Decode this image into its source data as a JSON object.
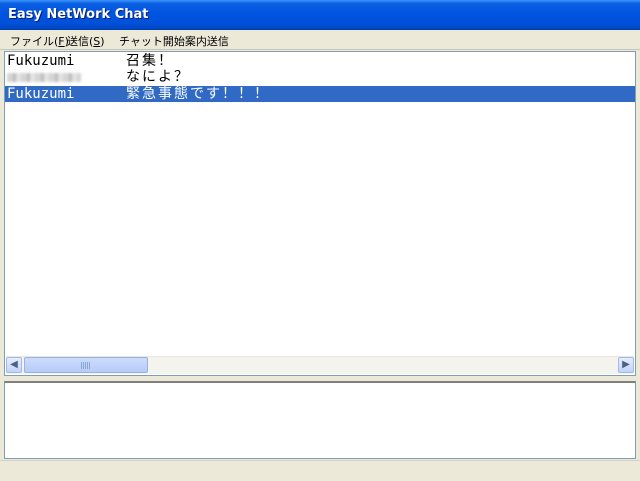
{
  "window": {
    "title": "Easy NetWork Chat"
  },
  "menu": {
    "file": {
      "label": "ファイル(",
      "key": "F",
      "close": ")"
    },
    "send": {
      "label": "送信(",
      "key": "S",
      "close": ")"
    },
    "chat_start": {
      "label": "チャット開始案内送信"
    }
  },
  "messages": [
    {
      "name": "Fukuzumi",
      "text": "召集！",
      "selected": false
    },
    {
      "name": "",
      "text": "なによ？",
      "selected": false,
      "name_obscured": true
    },
    {
      "name": "Fukuzumi",
      "text": "緊急事態です！！！",
      "selected": true
    }
  ],
  "input": {
    "value": ""
  },
  "colors": {
    "selection": "#316ac5",
    "title_bar": "#0054e3"
  },
  "icons": {
    "scroll_left": "chevron-left-icon",
    "scroll_right": "chevron-right-icon"
  }
}
